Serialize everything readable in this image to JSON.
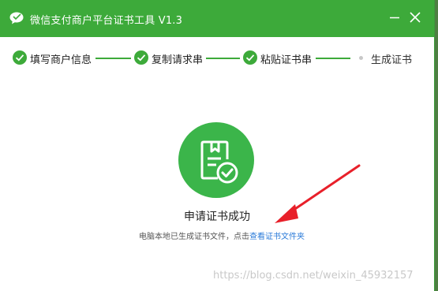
{
  "window": {
    "title": "微信支付商户平台证书工具 V1.3",
    "icons": {
      "logo": "wechat-pay-logo-icon",
      "minimize": "minimize-icon",
      "close": "close-icon"
    }
  },
  "steps": [
    {
      "label": "填写商户信息",
      "state": "done"
    },
    {
      "label": "复制请求串",
      "state": "done"
    },
    {
      "label": "粘贴证书串",
      "state": "done"
    },
    {
      "label": "生成证书",
      "state": "current"
    }
  ],
  "result": {
    "icon": "certificate-check-icon",
    "title": "申请证书成功",
    "desc_prefix": "电脑本地已生成证书文件，点击",
    "link_text": "查看证书文件夹"
  },
  "watermark": "https://blog.csdn.net/weixin_45932157",
  "colors": {
    "brand_green": "#3daa3a",
    "success_green": "#3bb54a",
    "link_blue": "#2b7bd9",
    "arrow_red": "#e8202a"
  }
}
